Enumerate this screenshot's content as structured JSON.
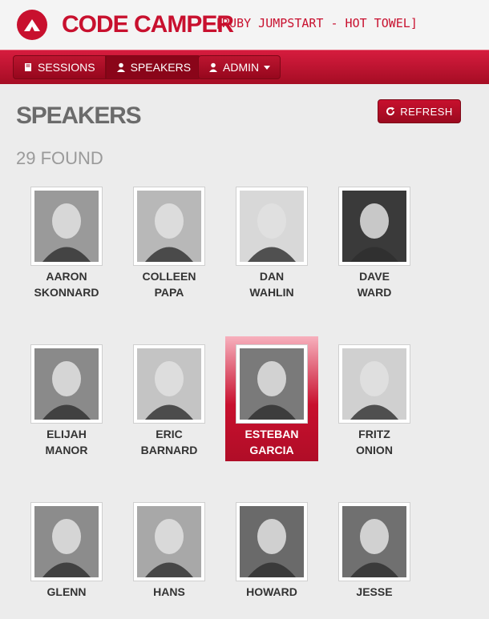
{
  "app": {
    "brand": "CODE CAMPER",
    "tagline": "[RUBY JUMPSTART - HOT TOWEL]",
    "accent_color": "#c8102e"
  },
  "nav": {
    "sessions_label": "SESSIONS",
    "speakers_label": "SPEAKERS",
    "admin_label": "ADMIN"
  },
  "page": {
    "title": "SPEAKERS",
    "refresh_label": "REFRESH",
    "found_text": "29 FOUND"
  },
  "speakers": [
    {
      "first": "AARON",
      "last": "SKONNARD",
      "shade": "#9a9a9a"
    },
    {
      "first": "COLLEEN",
      "last": "PAPA",
      "shade": "#b8b8b8"
    },
    {
      "first": "DAN",
      "last": "WAHLIN",
      "shade": "#d8d8d8"
    },
    {
      "first": "DAVE",
      "last": "WARD",
      "shade": "#3a3a3a"
    },
    {
      "first": "ELIJAH",
      "last": "MANOR",
      "shade": "#8a8a8a"
    },
    {
      "first": "ERIC",
      "last": "BARNARD",
      "shade": "#c4c4c4"
    },
    {
      "first": "ESTEBAN",
      "last": "GARCIA",
      "shade": "#7a7a7a",
      "selected": true
    },
    {
      "first": "FRITZ",
      "last": "ONION",
      "shade": "#d0d0d0"
    },
    {
      "first": "GLENN",
      "last": "",
      "shade": "#8c8c8c"
    },
    {
      "first": "HANS",
      "last": "",
      "shade": "#a8a8a8"
    },
    {
      "first": "HOWARD",
      "last": "",
      "shade": "#6a6a6a"
    },
    {
      "first": "JESSE",
      "last": "",
      "shade": "#707070"
    }
  ]
}
